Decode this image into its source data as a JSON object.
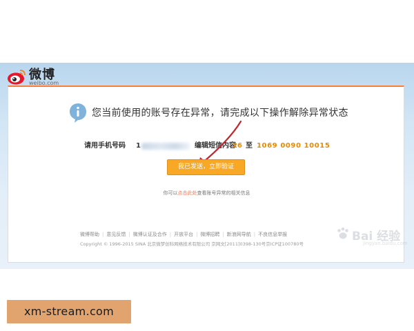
{
  "header": {
    "logo_text": "微博",
    "logo_domain": "weibo.com",
    "icon": "weibo-eye-logo-icon"
  },
  "notice": {
    "icon": "info-icon",
    "headline": "您当前使用的账号存在异常，请完成以下操作解除异常状态"
  },
  "sms": {
    "phone_label": "请用手机号码",
    "phone_value": "1",
    "edit_label": "编辑短信内容",
    "content_value": "26",
    "to_label": "至",
    "number_value": "1069 0090 10015"
  },
  "verify_button_label": "我已发送，立即验证",
  "help": {
    "prefix": "你可以",
    "link": "点击此处",
    "suffix": "查看账号异常的相关信息"
  },
  "footer": {
    "links": [
      "微博帮助",
      "意见反馈",
      "微博认证及合作",
      "开放平台",
      "微博招聘",
      "新浪网导航",
      "不良信息举报"
    ],
    "copyright": "Copyright © 1996-2015 SINA 北京微梦创科网络技术有限公司  京网文[2011]0398-130号京ICP证100780号"
  },
  "watermark": {
    "text": "Bai 经验",
    "sub": "jingyan.baidu.com"
  },
  "caption_tag": "xm-stream.com",
  "colors": {
    "accent_orange": "#f9a825",
    "highlight_value": "#e68a00",
    "link": "#eb7350",
    "arrow": "#c0282d"
  }
}
